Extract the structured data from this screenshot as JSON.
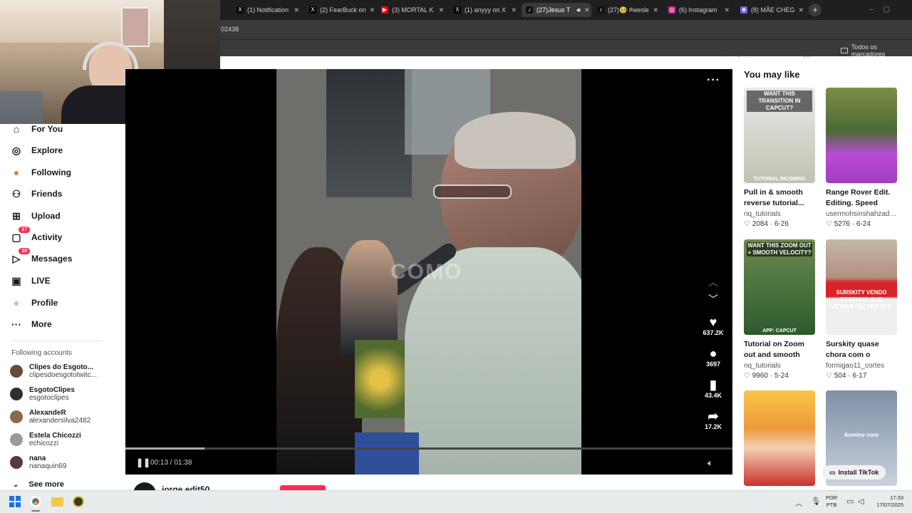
{
  "browser": {
    "tabs": [
      {
        "title": "(1) Notification",
        "color": "#000000",
        "glyph": "X"
      },
      {
        "title": "(2) FearBuck on",
        "color": "#000000",
        "glyph": "X"
      },
      {
        "title": "(3) MORTAL K",
        "color": "#ff0000",
        "glyph": "▶"
      },
      {
        "title": "(1) anyyy on X",
        "color": "#000000",
        "glyph": "X"
      },
      {
        "title": "(27)Jesus T",
        "color": "#111111",
        "glyph": "♪"
      },
      {
        "title": "(27)🥺 #wesle",
        "color": "#111111",
        "glyph": "♪"
      },
      {
        "title": "(6) Instagram",
        "color": "#d6249f",
        "glyph": "◎"
      },
      {
        "title": "(8) MÃE CHEG",
        "color": "#7b5cf0",
        "glyph": "■"
      }
    ],
    "url_fragment": "02438",
    "bookmarks_label": "Todos os marcadores"
  },
  "sidebar": {
    "nav": [
      {
        "label": "For You",
        "icon": "home-icon"
      },
      {
        "label": "Explore",
        "icon": "compass-icon"
      },
      {
        "label": "Following",
        "icon": "following-avatar-icon"
      },
      {
        "label": "Friends",
        "icon": "friends-icon"
      },
      {
        "label": "Upload",
        "icon": "upload-icon"
      },
      {
        "label": "Activity",
        "icon": "activity-icon",
        "badge": "17"
      },
      {
        "label": "Messages",
        "icon": "messages-icon",
        "badge": "10"
      },
      {
        "label": "LIVE",
        "icon": "live-icon"
      },
      {
        "label": "Profile",
        "icon": "profile-avatar-icon"
      },
      {
        "label": "More",
        "icon": "more-dots-icon"
      }
    ],
    "following_title": "Following accounts",
    "accounts": [
      {
        "name": "Clipes do Esgoto...",
        "handle": "clipesdoesgototwitc..."
      },
      {
        "name": "EsgotoClipes",
        "handle": "esgotoclipes"
      },
      {
        "name": "AlexandeR",
        "handle": "alexandersilva2482"
      },
      {
        "name": "Estela Chicozzi",
        "handle": "echicozzi"
      },
      {
        "name": "nana",
        "handle": "nanaquin69"
      }
    ],
    "see_more": "See more"
  },
  "video": {
    "time": "00:13 / 01:38",
    "progress": 0.13,
    "likes": "637.2K",
    "comments": "3697",
    "saves": "43.4K",
    "shares": "17.2K",
    "author": "jorge.edit50"
  },
  "right": {
    "title": "You may like",
    "cards": [
      {
        "title": "Pull in & smooth reverse tutorial...",
        "user": "nq_tutorials",
        "likes": "2084",
        "date": "6-26",
        "thumb_text": "WANT THIS TRANSITION IN CAPCUT?",
        "thumb_foot": "TUTORIAL INCOMING"
      },
      {
        "title": "Range Rover Edit. Editing. Speed Ram...",
        "user": "usermohsinshahzad1...",
        "likes": "5276",
        "date": "6-24",
        "thumb_text": "",
        "thumb_foot": ""
      },
      {
        "title": "Tutorial on Zoom out and smooth velocit...",
        "user": "nq_tutorials",
        "likes": "9960",
        "date": "5-24",
        "thumb_text": "WANT THIS ZOOM OUT + SMOOTH VELOCITY?",
        "thumb_foot": "APP: CAPCUT"
      },
      {
        "title": "Surskity quase chora com o desenho qu...",
        "user": "formigao11_cortes",
        "likes": "504",
        "date": "6-17",
        "thumb_text": "SURSKITY VENDO DESENHO QUE VIEWER FEZ PRA ELE",
        "thumb_foot": ""
      },
      {
        "title": "",
        "user": "",
        "likes": "",
        "date": "",
        "thumb_text": "",
        "thumb_foot": ""
      },
      {
        "title": "",
        "user": "",
        "likes": "",
        "date": "",
        "thumb_text": "Aomine core",
        "thumb_foot": ""
      }
    ],
    "install_label": "Install TikTok"
  },
  "taskbar": {
    "lang_top": "POR",
    "lang_bottom": "PTB",
    "time": "17:33",
    "date": "17/07/2025"
  }
}
